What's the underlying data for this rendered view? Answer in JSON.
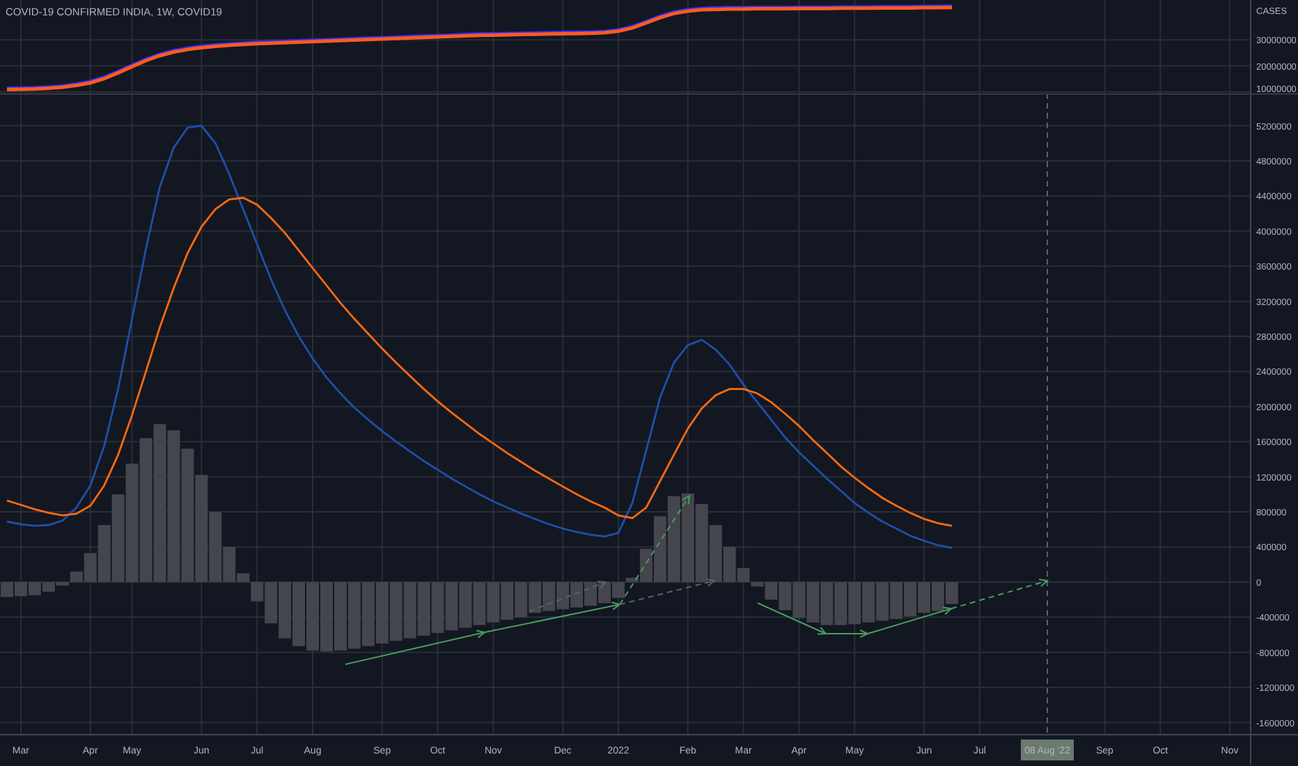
{
  "price_pane": {
    "chart_data": {
      "type": "line",
      "grid": true,
      "title": "COVID-19 CONFIRMED INDIA, 1W, COVID19",
      "ylabel": "CASES",
      "ylim": [
        9470000,
        45260000
      ],
      "yticks": [
        10000000,
        20000000,
        30000000
      ],
      "categories": [
        null,
        null,
        null,
        null,
        null,
        null,
        null,
        null,
        null,
        null,
        null,
        null,
        null,
        null,
        null,
        null,
        null,
        null,
        null,
        null,
        null,
        null,
        null,
        null,
        null,
        null,
        null,
        null,
        null,
        null,
        null,
        null,
        null,
        null,
        null,
        null,
        null,
        null,
        null,
        null,
        null,
        null,
        null,
        null,
        null,
        null,
        null,
        null,
        null,
        null,
        null,
        null,
        null,
        null,
        null,
        null,
        null,
        null,
        null,
        null,
        null,
        null,
        null,
        null,
        null,
        null,
        null,
        null,
        null,
        null,
        null,
        null,
        null,
        null,
        null,
        null,
        null,
        null,
        null,
        null,
        null,
        null,
        null,
        null,
        null,
        null,
        null,
        null,
        null,
        null
      ],
      "series": [
        {
          "color": "#3030ff",
          "values": [
            11400000,
            11500000,
            11600000,
            11900000,
            12300000,
            13000000,
            14000000,
            15600000,
            17800000,
            20200000,
            22500000,
            24400000,
            25800000,
            26800000,
            27500000,
            28000000,
            28400000,
            28700000,
            29000000,
            29200000,
            29400000,
            29600000,
            29800000,
            30000000,
            30200000,
            30400000,
            30600000,
            30800000,
            31000000,
            31200000,
            31400000,
            31600000,
            31800000,
            32000000,
            32200000,
            32300000,
            32400000,
            32500000,
            32600000,
            32700000,
            32800000,
            32900000,
            33000000,
            33200000,
            33800000,
            35000000,
            37000000,
            39000000,
            40600000,
            41500000,
            42000000,
            42200000,
            42300000,
            42300000,
            42400000,
            42400000,
            42400000,
            42500000,
            42500000,
            42500000,
            42600000,
            42600000,
            42600000,
            42700000,
            42700000,
            42700000,
            42800000,
            42800000,
            42900000,
            null,
            null,
            null,
            null,
            null,
            null,
            null,
            null,
            null,
            null,
            null,
            null,
            null,
            null,
            null,
            null,
            null,
            null,
            null,
            null,
            null
          ]
        },
        {
          "color": "#ff5a1f",
          "values": [
            10900000,
            11000000,
            11100000,
            11400000,
            11800000,
            12500000,
            13500000,
            15100000,
            17300000,
            19700000,
            22000000,
            23900000,
            25300000,
            26300000,
            27000000,
            27500000,
            27900000,
            28200000,
            28500000,
            28700000,
            28900000,
            29100000,
            29300000,
            29500000,
            29700000,
            29900000,
            30100000,
            30300000,
            30500000,
            30700000,
            30900000,
            31100000,
            31300000,
            31500000,
            31700000,
            31800000,
            31900000,
            32000000,
            32100000,
            32200000,
            32300000,
            32400000,
            32500000,
            32700000,
            33300000,
            34500000,
            36500000,
            38500000,
            40100000,
            41000000,
            41500000,
            41700000,
            41800000,
            41800000,
            41900000,
            41900000,
            41900000,
            42000000,
            42000000,
            42000000,
            42100000,
            42100000,
            42100000,
            42200000,
            42200000,
            42200000,
            42300000,
            42300000,
            42400000,
            null,
            null,
            null,
            null,
            null,
            null,
            null,
            null,
            null,
            null,
            null,
            null,
            null,
            null,
            null,
            null,
            null,
            null,
            null,
            null,
            null
          ]
        }
      ]
    }
  },
  "indicator_pane": {
    "histogram": {
      "chart_data": {
        "type": "bar",
        "grid": true,
        "ylim": [
          -2080000,
          5570000
        ],
        "yticks": [
          5200000,
          4800000,
          4400000,
          4000000,
          3600000,
          3200000,
          2800000,
          2400000,
          2000000,
          1600000,
          1200000,
          800000,
          400000,
          0,
          -400000,
          -800000,
          -1200000,
          -1600000
        ],
        "categories": [
          null,
          "Mar",
          null,
          null,
          null,
          null,
          "Apr",
          null,
          null,
          "May",
          null,
          null,
          null,
          null,
          "Jun",
          null,
          null,
          null,
          "Jul",
          null,
          null,
          null,
          "Aug",
          null,
          null,
          null,
          null,
          "Sep",
          null,
          null,
          null,
          "Oct",
          null,
          null,
          null,
          "Nov",
          null,
          null,
          null,
          null,
          "Dec",
          null,
          null,
          null,
          "2022",
          null,
          null,
          null,
          null,
          "Feb",
          null,
          null,
          null,
          "Mar",
          null,
          null,
          null,
          "Apr",
          null,
          null,
          null,
          "May",
          null,
          null,
          null,
          null,
          "Jun",
          null,
          null,
          null,
          "Jul",
          null,
          null,
          null,
          null,
          null,
          null,
          null,
          null,
          "Sep",
          null,
          null,
          null,
          "Oct",
          null,
          null,
          null,
          null,
          "Nov",
          null
        ],
        "series": [
          {
            "color": "#45464d",
            "values": [
              -170000,
              -160000,
              -150000,
              -110000,
              -40000,
              120000,
              330000,
              650000,
              1000000,
              1350000,
              1640000,
              1800000,
              1730000,
              1520000,
              1220000,
              800000,
              400000,
              100000,
              -220000,
              -470000,
              -640000,
              -730000,
              -780000,
              -790000,
              -780000,
              -760000,
              -730000,
              -700000,
              -670000,
              -640000,
              -610000,
              -580000,
              -550000,
              -520000,
              -490000,
              -460000,
              -430000,
              -400000,
              -350000,
              -330000,
              -310000,
              -290000,
              -270000,
              -240000,
              -180000,
              50000,
              380000,
              750000,
              980000,
              1010000,
              890000,
              650000,
              400000,
              160000,
              -50000,
              -200000,
              -320000,
              -410000,
              -460000,
              -490000,
              -490000,
              -480000,
              -460000,
              -440000,
              -420000,
              -390000,
              -350000,
              -330000,
              -250000,
              null,
              null,
              null,
              null,
              null,
              null,
              null,
              null,
              null,
              null,
              null,
              null,
              null,
              null,
              null,
              null,
              null,
              null,
              null,
              null,
              null
            ]
          }
        ]
      }
    },
    "chart_data": {
      "type": "line",
      "ylim": [
        -2080000,
        5570000
      ],
      "categories": [
        null,
        null,
        null,
        null,
        null,
        null,
        null,
        null,
        null,
        null,
        null,
        null,
        null,
        null,
        null,
        null,
        null,
        null,
        null,
        null,
        null,
        null,
        null,
        null,
        null,
        null,
        null,
        null,
        null,
        null,
        null,
        null,
        null,
        null,
        null,
        null,
        null,
        null,
        null,
        null,
        null,
        null,
        null,
        null,
        null,
        null,
        null,
        null,
        null,
        null,
        null,
        null,
        null,
        null,
        null,
        null,
        null,
        null,
        null,
        null,
        null,
        null,
        null,
        null,
        null,
        null,
        null,
        null,
        null,
        null,
        null,
        null,
        null,
        null,
        null,
        null,
        null,
        null,
        null,
        null,
        null,
        null,
        null,
        null,
        null,
        null,
        null,
        null,
        null,
        null
      ],
      "series": [
        {
          "color": "#1f4fa8",
          "values": [
            690000,
            660000,
            640000,
            650000,
            700000,
            850000,
            1100000,
            1550000,
            2200000,
            3000000,
            3800000,
            4500000,
            4950000,
            5180000,
            5200000,
            5000000,
            4650000,
            4250000,
            3850000,
            3450000,
            3100000,
            2800000,
            2550000,
            2330000,
            2150000,
            1990000,
            1850000,
            1720000,
            1600000,
            1490000,
            1380000,
            1280000,
            1180000,
            1090000,
            1000000,
            920000,
            850000,
            780000,
            720000,
            660000,
            610000,
            570000,
            540000,
            520000,
            560000,
            900000,
            1500000,
            2100000,
            2500000,
            2700000,
            2760000,
            2650000,
            2480000,
            2250000,
            2050000,
            1850000,
            1650000,
            1480000,
            1330000,
            1180000,
            1040000,
            900000,
            790000,
            690000,
            610000,
            530000,
            470000,
            420000,
            390000,
            null,
            null,
            null,
            null,
            null,
            null,
            null,
            null,
            null,
            null,
            null,
            null,
            null,
            null,
            null,
            null,
            null,
            null,
            null,
            null,
            null
          ]
        },
        {
          "color": "#ff6a10",
          "values": [
            930000,
            880000,
            830000,
            790000,
            760000,
            780000,
            870000,
            1100000,
            1450000,
            1900000,
            2400000,
            2900000,
            3350000,
            3750000,
            4050000,
            4250000,
            4360000,
            4380000,
            4300000,
            4150000,
            3980000,
            3780000,
            3580000,
            3380000,
            3180000,
            3000000,
            2830000,
            2660000,
            2500000,
            2350000,
            2200000,
            2060000,
            1930000,
            1810000,
            1690000,
            1580000,
            1470000,
            1370000,
            1270000,
            1180000,
            1090000,
            1000000,
            920000,
            850000,
            760000,
            730000,
            850000,
            1150000,
            1450000,
            1750000,
            1980000,
            2130000,
            2200000,
            2200000,
            2150000,
            2050000,
            1920000,
            1780000,
            1620000,
            1470000,
            1320000,
            1190000,
            1070000,
            960000,
            870000,
            790000,
            720000,
            670000,
            640000,
            null,
            null,
            null,
            null,
            null,
            null,
            null,
            null,
            null,
            null,
            null,
            null,
            null,
            null,
            null,
            null,
            null,
            null,
            null,
            null,
            null
          ]
        }
      ]
    },
    "crosshair": {
      "label": "08 Aug '22"
    }
  }
}
